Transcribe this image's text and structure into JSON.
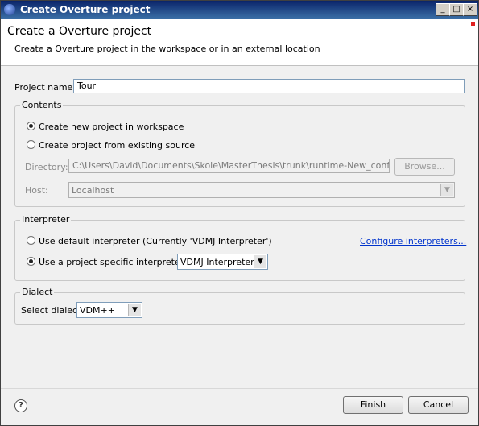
{
  "window": {
    "title": "Create Overture project",
    "minimize_glyph": "_",
    "maximize_glyph": "□",
    "close_glyph": "×"
  },
  "header": {
    "title": "Create a Overture project",
    "description": "Create a Overture project in the workspace or in an external location"
  },
  "project_name": {
    "label": "Project name:",
    "value": "Tour"
  },
  "contents": {
    "legend": "Contents",
    "option_new": "Create new project in workspace",
    "option_existing": "Create project from existing source",
    "directory_label": "Directory:",
    "directory_value": "C:\\Users\\David\\Documents\\Skole\\MasterThesis\\trunk\\runtime-New_configuration\\",
    "browse_label": "Browse...",
    "host_label": "Host:",
    "host_value": "Localhost",
    "selected": "new"
  },
  "interpreter": {
    "legend": "Interpreter",
    "option_default": "Use default interpreter (Currently 'VDMJ Interpreter')",
    "option_specific": "Use a project specific interpreter:",
    "specific_value": "VDMJ Interpreter",
    "configure_link": "Configure interpreters...",
    "selected": "specific"
  },
  "dialect": {
    "legend": "Dialect",
    "label": "Select dialect",
    "value": "VDM++"
  },
  "footer": {
    "help_glyph": "?",
    "finish_label": "Finish",
    "cancel_label": "Cancel"
  },
  "icons": {
    "dropdown_arrow": "▼"
  }
}
